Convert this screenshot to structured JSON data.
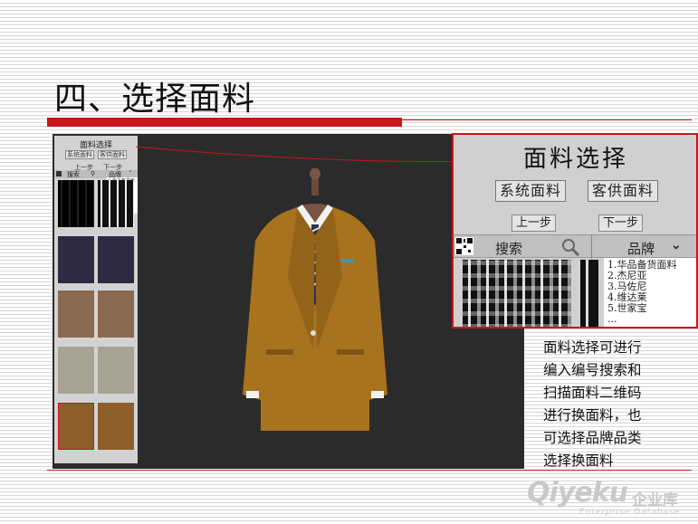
{
  "slide": {
    "title": "四、选择面料",
    "description_lines": [
      "面料选择可进行",
      "编入编号搜索和",
      "扫描面料二维码",
      "进行换面料，也",
      "可选择品牌品类",
      "选择换面料"
    ]
  },
  "app": {
    "panel_title": "面料选择",
    "system_fabric": "系统面料",
    "customer_fabric": "客供面料",
    "prev_step": "上一步",
    "next_step": "下一步",
    "search_label": "搜索",
    "brand_label": "品牌",
    "brand_options": [
      "1.华品备货面料",
      "2.杰尼亚",
      "3.马佐尼",
      "4.维达莱",
      "5.世家宝",
      "..."
    ]
  },
  "watermark": {
    "brand": "Qiyeku",
    "brand_cn": "企业库",
    "tagline": "Enterprise Database"
  },
  "colors": {
    "accent_red": "#c8161d",
    "panel_dark": "#2b2b2b",
    "suit_mustard": "#a8731f"
  }
}
